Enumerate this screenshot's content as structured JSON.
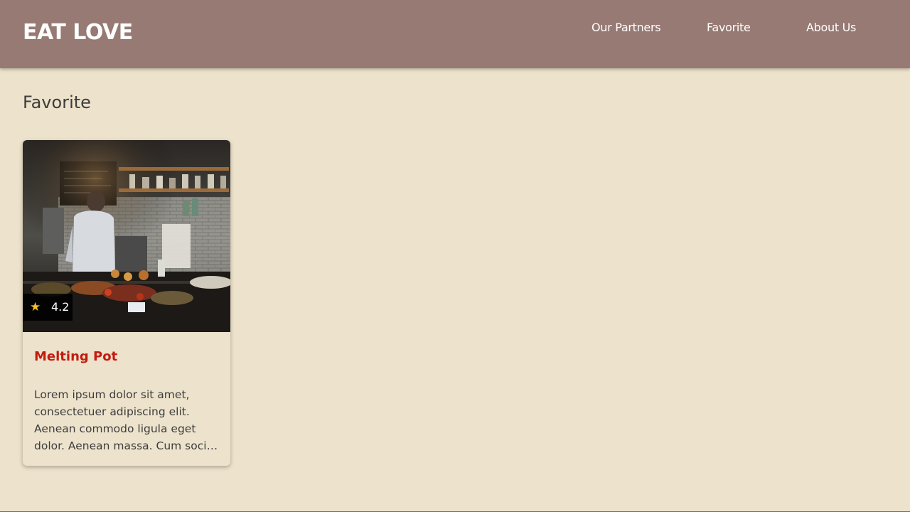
{
  "navbar": {
    "brand": "EAT LOVE",
    "links": [
      "Our Partners",
      "Favorite",
      "About Us"
    ]
  },
  "page": {
    "title": "Favorite"
  },
  "restaurants": [
    {
      "name": "Melting Pot",
      "rating": "4.2",
      "description": "Lorem ipsum dolor sit amet, consectetuer adipiscing elit. Aenean commodo ligula eget dolor. Aenean massa. Cum sociis natoque penatibus et magnis dis parturient montes."
    }
  ],
  "icons": {
    "rating": "star-icon"
  },
  "colors": {
    "navbar_bg": "#977a73",
    "page_bg": "#ede2cb",
    "title_red": "#c41b10",
    "star_yellow": "#f5c026"
  }
}
